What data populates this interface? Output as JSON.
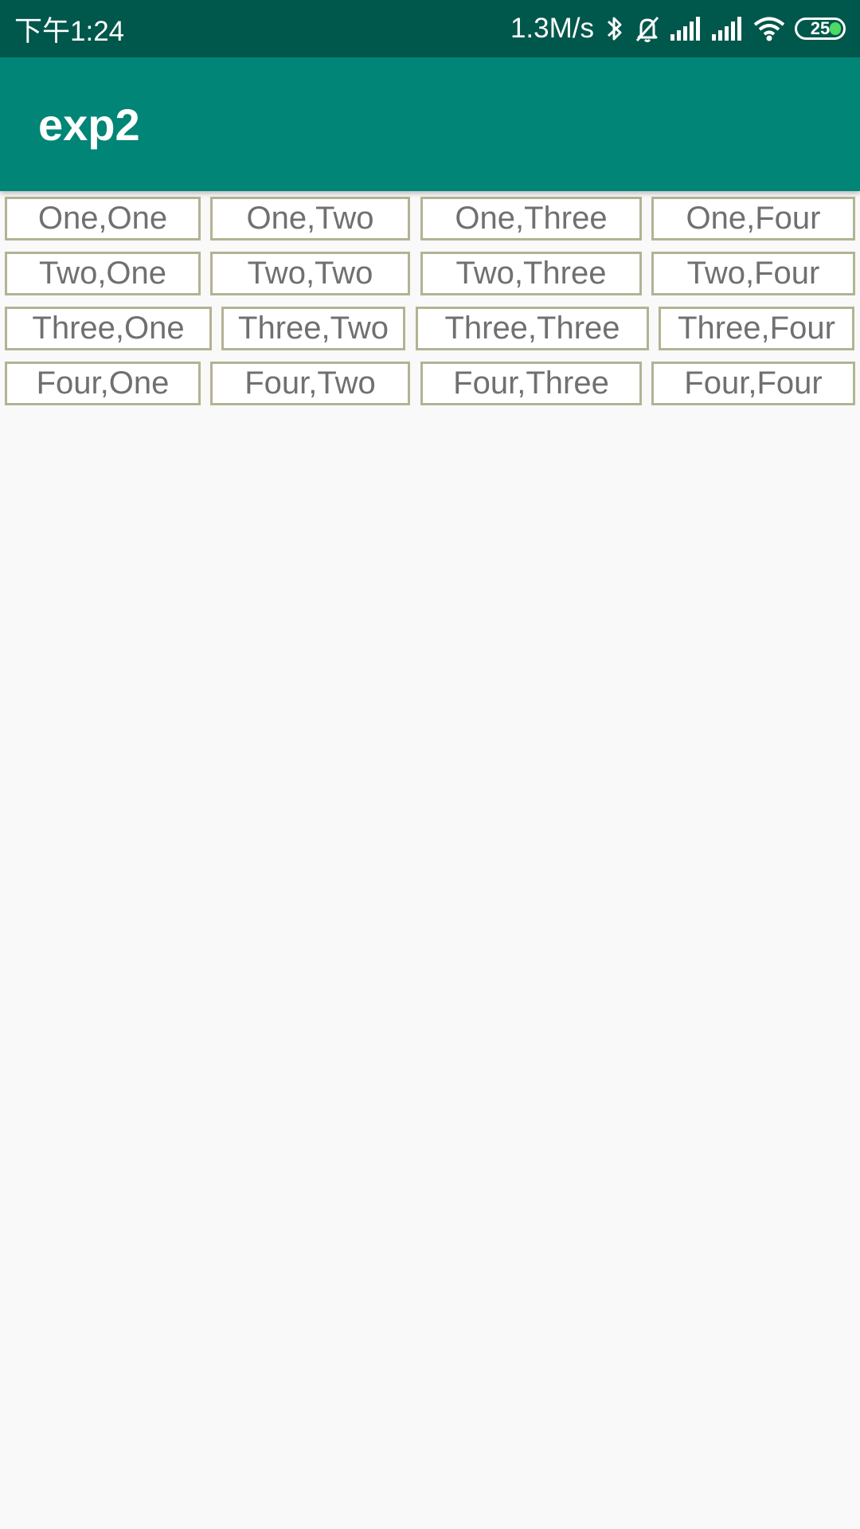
{
  "status_bar": {
    "time": "下午1:24",
    "net_speed": "1.3M/s",
    "battery_level": "25",
    "icons": [
      "bluetooth-icon",
      "bell-off-icon",
      "signal-icon",
      "signal-icon",
      "wifi-icon",
      "battery-icon"
    ],
    "battery_color": "#4cd964"
  },
  "app_bar": {
    "title": "exp2",
    "color": "#008577"
  },
  "grid": {
    "rows": [
      [
        "One,One",
        "One,Two",
        "One,Three",
        "One,Four"
      ],
      [
        "Two,One",
        "Two,Two",
        "Two,Three",
        "Two,Four"
      ],
      [
        "Three,One",
        "Three,Two",
        "Three,Three",
        "Three,Four"
      ],
      [
        "Four,One",
        "Four,Two",
        "Four,Three",
        "Four,Four"
      ]
    ]
  }
}
